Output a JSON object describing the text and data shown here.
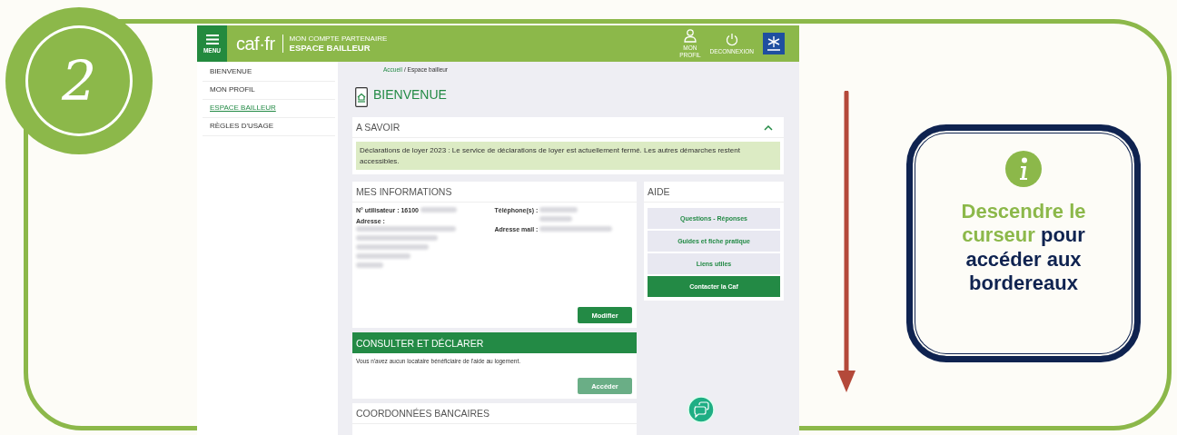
{
  "step": {
    "number": "2"
  },
  "screenshot": {
    "header": {
      "menu_label": "MENU",
      "logo": "caf·fr",
      "subtitle": "MON COMPTE PARTENAIRE",
      "title": "ESPACE BAILLEUR",
      "actions": [
        {
          "kind": "profile",
          "label": "MON PROFIL"
        },
        {
          "kind": "power",
          "label": "DECONNEXION"
        }
      ]
    },
    "sidebar": {
      "items": [
        {
          "label": "BIENVENUE",
          "selected": false
        },
        {
          "label": "MON PROFIL",
          "selected": false
        },
        {
          "label": "ESPACE BAILLEUR",
          "selected": true
        },
        {
          "label": "RÈGLES D'USAGE",
          "selected": false
        }
      ]
    },
    "breadcrumb": {
      "link": "Accueil",
      "current": "/ Espace bailleur"
    },
    "page_title": "BIENVENUE",
    "notice": {
      "title": "A SAVOIR",
      "expanded": true,
      "text": "Déclarations de loyer 2023 : Le service de déclarations de loyer est actuellement fermé. Les autres démarches restent accessibles."
    },
    "info": {
      "title": "MES INFORMATIONS",
      "fields": [
        {
          "kind": "id",
          "label": "N° utilisateur :",
          "value": "16100"
        },
        {
          "kind": "phone",
          "label": "Téléphone(s) :"
        },
        {
          "kind": "address",
          "label": "Adresse :"
        },
        {
          "kind": "email",
          "label": "Adresse mail :"
        }
      ],
      "button": "Modifier"
    },
    "help": {
      "title": "AIDE",
      "links": [
        {
          "kind": "link",
          "label": "Questions - Réponses"
        },
        {
          "kind": "link",
          "label": "Guides et fiche pratique"
        },
        {
          "kind": "link",
          "label": "Liens utiles"
        },
        {
          "kind": "primary",
          "label": "Contacter la Caf"
        }
      ]
    },
    "declare": {
      "title": "CONSULTER ET DÉCLARER",
      "text": "Vous n'avez aucun locataire bénéficiaire de l'aide au logement.",
      "button": "Accéder",
      "disabled": true
    },
    "bank": {
      "title": "COORDONNÉES BANCAIRES"
    }
  },
  "tip": {
    "highlight": "Descendre le curseur",
    "text": "pour accéder aux bordereaux"
  }
}
